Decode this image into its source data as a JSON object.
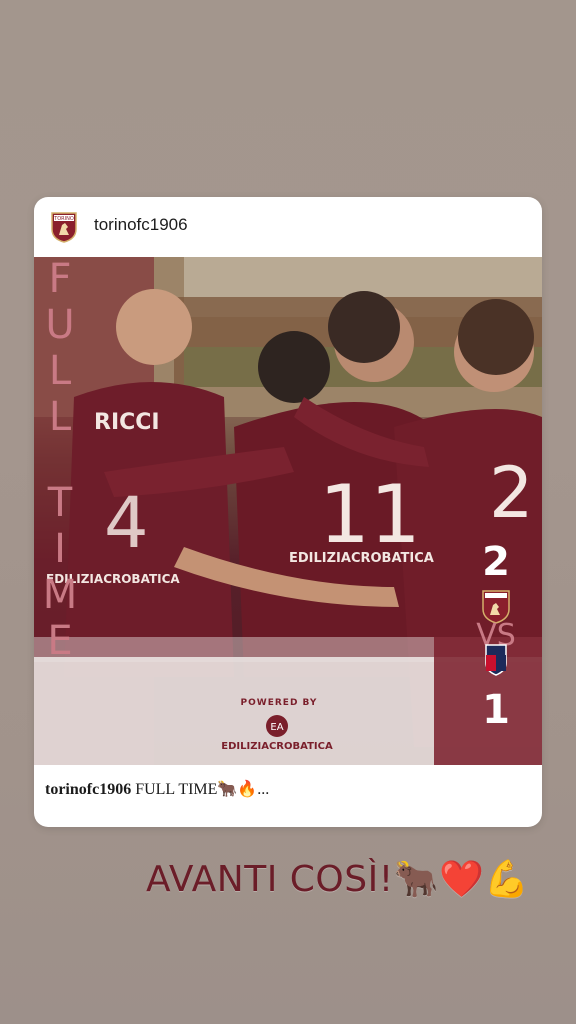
{
  "post": {
    "username": "torinofc1906",
    "caption_user": "torinofc1906",
    "caption_text": "FULL TIME🐂🔥...",
    "graphic": {
      "vertical_text": [
        "F",
        "U",
        "L",
        "L",
        "T",
        "I",
        "M",
        "E"
      ],
      "score_home": "2",
      "score_away": "1",
      "vs": "VS",
      "powered_by": "POWERED BY",
      "sponsor": "EDILIZIACROBATICA",
      "sponsor_mark": "EA",
      "jersey_name": "RICCI",
      "jersey_number_left": "4",
      "jersey_number_center": "11",
      "jersey_number_right": "2",
      "jersey_sponsor": "EDILIZIACROBATICA",
      "home_crest": "TORINO",
      "away_crest": "BFC"
    }
  },
  "story": {
    "text": "AVANTI COSÌ!🐂❤️💪"
  },
  "colors": {
    "torino_maroon": "#7a1f2b",
    "story_text": "#6b1d28",
    "background": "#a3968d"
  }
}
